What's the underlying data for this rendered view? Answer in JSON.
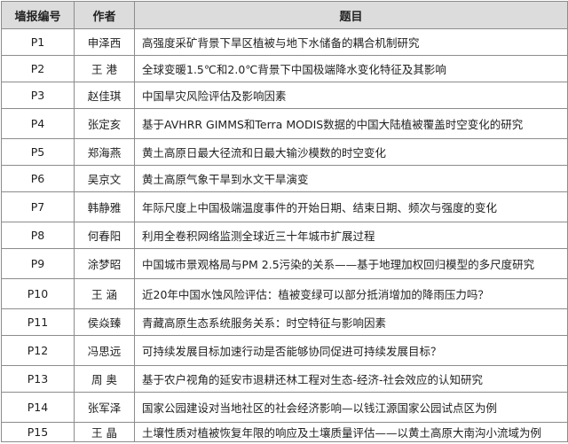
{
  "table": {
    "headers": {
      "id": "墙报编号",
      "author": "作者",
      "title": "题目"
    },
    "rows": [
      {
        "id": "P1",
        "author": "申泽西",
        "title": "高强度采矿背景下旱区植被与地下水储备的耦合机制研究"
      },
      {
        "id": "P2",
        "author": "王  港",
        "title": "全球变暖1.5℃和2.0℃背景下中国极端降水变化特征及其影响"
      },
      {
        "id": "P3",
        "author": "赵佳琪",
        "title": "中国旱灾风险评估及影响因素"
      },
      {
        "id": "P4",
        "author": "张定亥",
        "title": "基于AVHRR GIMMS和Terra MODIS数据的中国大陆植被覆盖时空变化的研究"
      },
      {
        "id": "P5",
        "author": "郑海燕",
        "title": "黄土高原日最大径流和日最大输沙模数的时空变化"
      },
      {
        "id": "P6",
        "author": "吴京文",
        "title": "黄土高原气象干旱到水文干旱演变"
      },
      {
        "id": "P7",
        "author": "韩静雅",
        "title": "年际尺度上中国极端温度事件的开始日期、结束日期、频次与强度的变化"
      },
      {
        "id": "P8",
        "author": "何春阳",
        "title": "利用全卷积网络监测全球近三十年城市扩展过程"
      },
      {
        "id": "P9",
        "author": "涂梦昭",
        "title": "中国城市景观格局与PM 2.5污染的关系——基于地理加权回归模型的多尺度研究"
      },
      {
        "id": "P10",
        "author": "王  涵",
        "title": "近20年中国水蚀风险评估：植被变绿可以部分抵消增加的降雨压力吗？"
      },
      {
        "id": "P11",
        "author": "侯焱臻",
        "title": "青藏高原生态系统服务关系：时空特征与影响因素"
      },
      {
        "id": "P12",
        "author": "冯思远",
        "title": "可持续发展目标加速行动是否能够协同促进可持续发展目标？"
      },
      {
        "id": "P13",
        "author": "周  奥",
        "title": "基于农户视角的延安市退耕还林工程对生态-经济-社会效应的认知研究"
      },
      {
        "id": "P14",
        "author": "张军泽",
        "title": "国家公园建设对当地社区的社会经济影响—以钱江源国家公园试点区为例"
      },
      {
        "id": "P15",
        "author": "王  晶",
        "title": "土壤性质对植被恢复年限的响应及土壤质量评估——以黄土高原大南沟小流域为例"
      }
    ]
  }
}
